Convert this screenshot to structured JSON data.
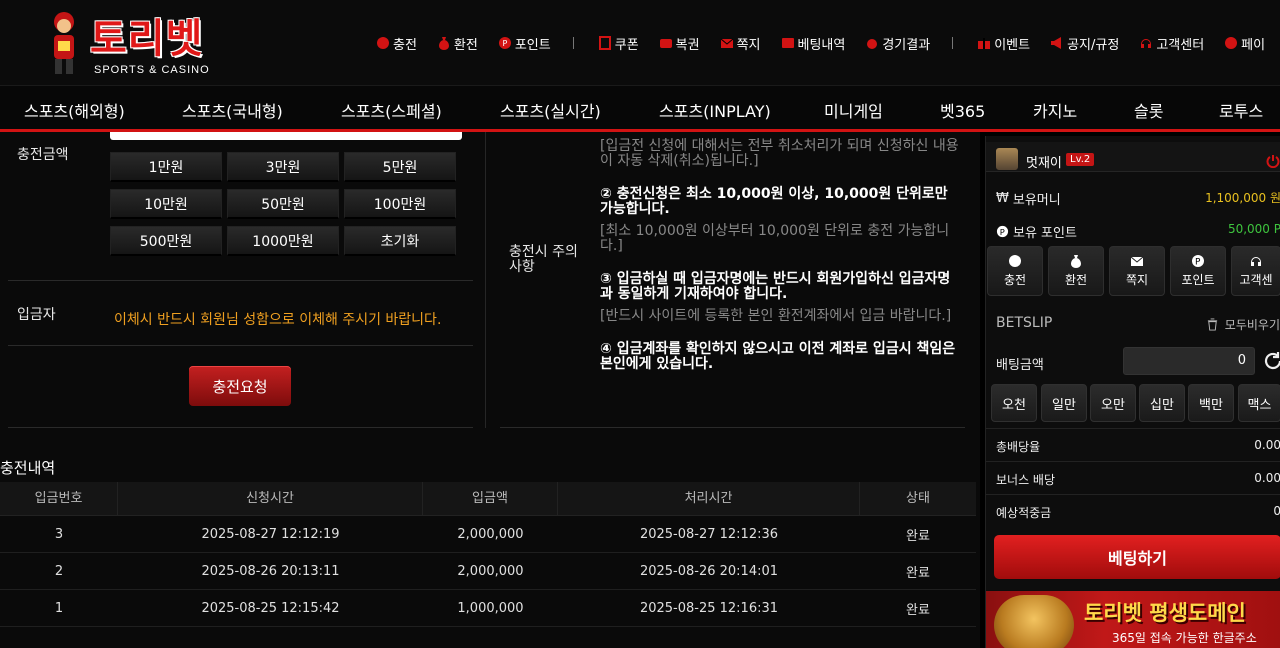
{
  "brand": {
    "name": "토리벳",
    "tagline": "SPORTS & CASINO"
  },
  "top_links": [
    {
      "label": "충전",
      "icon": "coin-icon"
    },
    {
      "label": "환전",
      "icon": "money-bag-icon"
    },
    {
      "label": "포인트",
      "icon": "point-icon"
    },
    {
      "label": "쿠폰",
      "icon": "coupon-icon"
    },
    {
      "label": "복권",
      "icon": "lottery-icon"
    },
    {
      "label": "쪽지",
      "icon": "mail-icon"
    },
    {
      "label": "베팅내역",
      "icon": "bet-history-icon"
    },
    {
      "label": "경기결과",
      "icon": "result-icon"
    },
    {
      "label": "이벤트",
      "icon": "gift-icon"
    },
    {
      "label": "공지/규정",
      "icon": "megaphone-icon"
    },
    {
      "label": "고객센터",
      "icon": "headset-icon"
    },
    {
      "label": "페이",
      "icon": "pay-icon"
    }
  ],
  "nav": [
    "스포츠(해외형)",
    "스포츠(국내형)",
    "스포츠(스페셜)",
    "스포츠(실시간)",
    "스포츠(INPLAY)",
    "미니게임",
    "벳365",
    "카지노",
    "슬롯",
    "로투스"
  ],
  "form": {
    "amount_label": "충전금액",
    "amount_buttons": [
      "1만원",
      "3만원",
      "5만원",
      "10만원",
      "50만원",
      "100만원",
      "500만원",
      "1000만원",
      "초기화"
    ],
    "depositor_label": "입금자",
    "depositor_notice": "이체시 반드시 회원님 성함으로 이체해 주시기 바랍니다.",
    "submit_label": "충전요청",
    "caution_label": "충전시 주의사항",
    "notes": [
      {
        "type": "gray",
        "text": "[입금전 신청에 대해서는 전부 취소처리가 되며 신청하신 내용이 자동 삭제(취소)됩니다.]"
      },
      {
        "type": "bold",
        "text": "② 충전신청은 최소 10,000원 이상, 10,000원 단위로만 가능합니다."
      },
      {
        "type": "gray",
        "text": "[최소 10,000원 이상부터 10,000원 단위로 충전 가능합니다.]"
      },
      {
        "type": "bold",
        "text": "③ 입금하실 때 입금자명에는 반드시 회원가입하신 입금자명과 동일하게 기재하여야 합니다."
      },
      {
        "type": "gray",
        "text": "[반드시 사이트에 등록한 본인 환전계좌에서 입금 바랍니다.]"
      },
      {
        "type": "bold",
        "text": "④ 입금계좌를 확인하지 않으시고 이전 계좌로 입금시 책임은 본인에게 있습니다."
      }
    ]
  },
  "history": {
    "title": "충전내역",
    "columns": [
      "입금번호",
      "신청시간",
      "입금액",
      "처리시간",
      "상태"
    ],
    "rows": [
      [
        "3",
        "2025-08-27 12:12:19",
        "2,000,000",
        "2025-08-27 12:12:36",
        "완료"
      ],
      [
        "2",
        "2025-08-26 20:13:11",
        "2,000,000",
        "2025-08-26 20:14:01",
        "완료"
      ],
      [
        "1",
        "2025-08-25 12:15:42",
        "1,000,000",
        "2025-08-25 12:16:31",
        "완료"
      ]
    ]
  },
  "sidebar": {
    "username": "멋재이",
    "level": "Lv.2",
    "money_label": "보유머니",
    "money_value": "1,100,000 원",
    "points_label": "보유 포인트",
    "points_value": "50,000 P",
    "quick": [
      "충전",
      "환전",
      "쪽지",
      "포인트",
      "고객센"
    ],
    "betslip_title": "BETSLIP",
    "clear_all": "모두비우기",
    "bet_amount_label": "배팅금액",
    "bet_amount_value": "0",
    "chips": [
      "오천",
      "일만",
      "오만",
      "십만",
      "백만",
      "맥스"
    ],
    "total_odds_label": "총배당율",
    "total_odds_value": "0.00",
    "bonus_label": "보너스 배당",
    "bonus_value": "0.00",
    "expected_label": "예상적중금",
    "expected_value": "0",
    "bet_button": "베팅하기",
    "banner_title": "토리벳 평생도메인",
    "banner_sub": "365일 접속 가능한 한글주소"
  },
  "colors": {
    "accent": "#d21313",
    "gold": "#e8c020",
    "green": "#3ec43e",
    "notice": "#f0a020"
  }
}
